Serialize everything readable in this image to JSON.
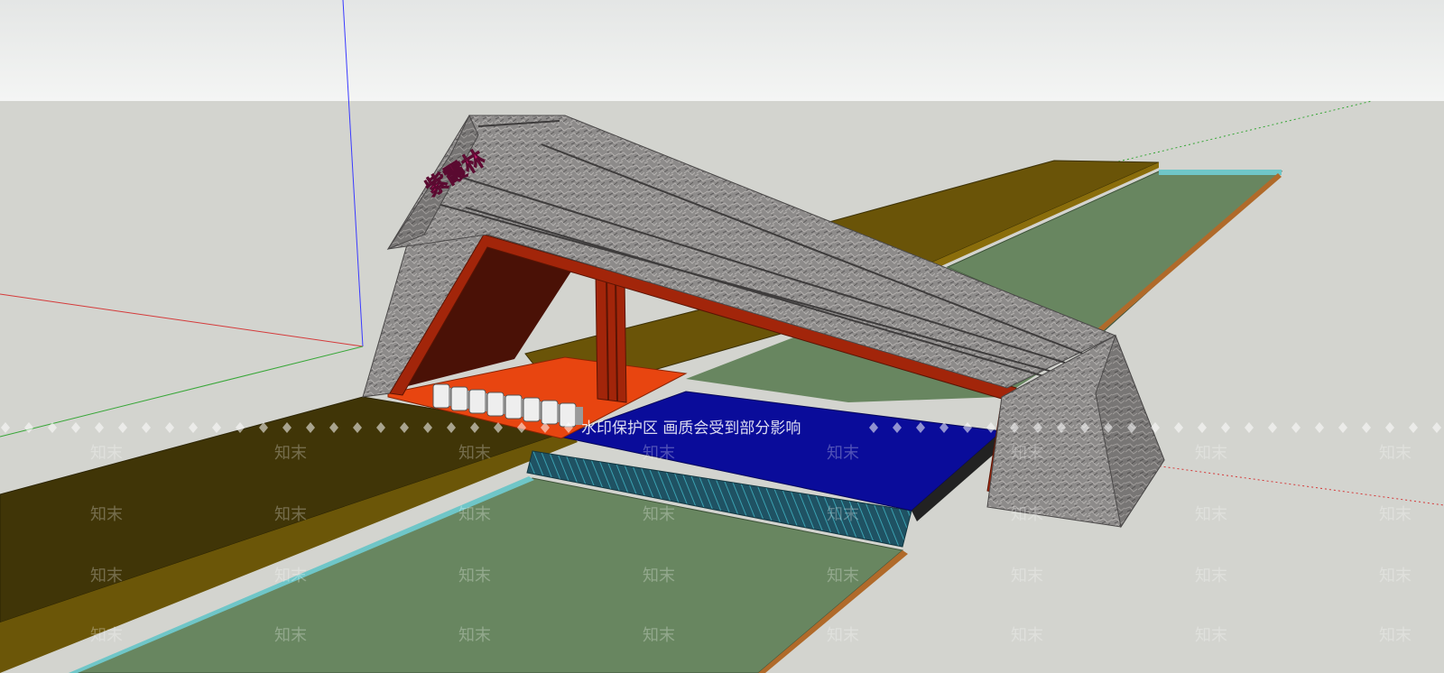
{
  "scene": {
    "sign_text": "紫霞林",
    "colors": {
      "sky_top": "#e7e9e8",
      "sky_bottom": "#f3f4f3",
      "ground": "#d3d4cf",
      "stone": "#8a8887",
      "stone_dark": "#6f6d6c",
      "stone_light": "#a8a6a4",
      "red_frame": "#a2250a",
      "red_inner": "#4a1106",
      "orange_floor": "#e84510",
      "blue_water": "#0a0c9a",
      "teal_steps": "#245a6a",
      "olive": "#6a5408",
      "olive_dark": "#423705",
      "green": "#688660",
      "sign": "#c2186a",
      "axis_blue": "#3a3aff",
      "axis_red": "#d43a3a",
      "axis_green": "#36a636"
    }
  },
  "watermark": {
    "banner": "水印保护区  画质会受到部分影响",
    "tile": "知末"
  }
}
